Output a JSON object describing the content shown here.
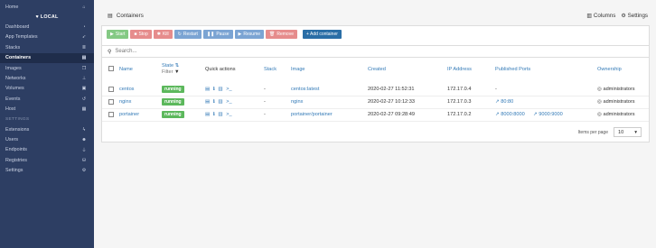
{
  "sidebar": {
    "home": "Home",
    "endpoint": "LOCAL",
    "items": [
      {
        "label": "Dashboard",
        "icon": "tachometer-icon"
      },
      {
        "label": "App Templates",
        "icon": "rocket-icon"
      },
      {
        "label": "Stacks",
        "icon": "list-icon"
      },
      {
        "label": "Containers",
        "icon": "server-icon"
      },
      {
        "label": "Images",
        "icon": "clone-icon"
      },
      {
        "label": "Networks",
        "icon": "sitemap-icon"
      },
      {
        "label": "Volumes",
        "icon": "cubes-icon"
      },
      {
        "label": "Events",
        "icon": "history-icon"
      },
      {
        "label": "Host",
        "icon": "th-icon"
      }
    ],
    "section": "SETTINGS",
    "settings_items": [
      {
        "label": "Extensions",
        "icon": "bolt-icon"
      },
      {
        "label": "Users",
        "icon": "users-icon"
      },
      {
        "label": "Endpoints",
        "icon": "plug-icon"
      },
      {
        "label": "Registries",
        "icon": "database-icon"
      },
      {
        "label": "Settings",
        "icon": "cogs-icon"
      }
    ]
  },
  "header": {
    "title": "Containers",
    "columns": "Columns",
    "settings": "Settings"
  },
  "actions": {
    "start": "Start",
    "stop": "Stop",
    "kill": "Kill",
    "restart": "Restart",
    "pause": "Pause",
    "resume": "Resume",
    "remove": "Remove",
    "add": "+ Add container"
  },
  "search": {
    "placeholder": "Search..."
  },
  "table": {
    "headers": {
      "name": "Name",
      "state": "State",
      "filter": "Filter",
      "quick_actions": "Quick actions",
      "stack": "Stack",
      "image": "Image",
      "created": "Created",
      "ip": "IP Address",
      "ports": "Published Ports",
      "ownership": "Ownership"
    },
    "rows": [
      {
        "name": "centos",
        "state": "running",
        "stack": "-",
        "image": "centos:latest",
        "created": "2020-02-27 11:52:31",
        "ip": "172.17.0.4",
        "ports": [
          "-"
        ],
        "ownership": "administrators"
      },
      {
        "name": "nginx",
        "state": "running",
        "stack": "-",
        "image": "nginx",
        "created": "2020-02-27 10:12:33",
        "ip": "172.17.0.3",
        "ports": [
          "80:80"
        ],
        "ownership": "administrators"
      },
      {
        "name": "portainer",
        "state": "running",
        "stack": "-",
        "image": "portainer/portainer",
        "created": "2020-02-27 09:28:49",
        "ip": "172.17.0.2",
        "ports": [
          "8000:8000",
          "9000:9000"
        ],
        "ownership": "administrators"
      }
    ]
  },
  "pagination": {
    "label": "Items per page",
    "value": "10"
  }
}
